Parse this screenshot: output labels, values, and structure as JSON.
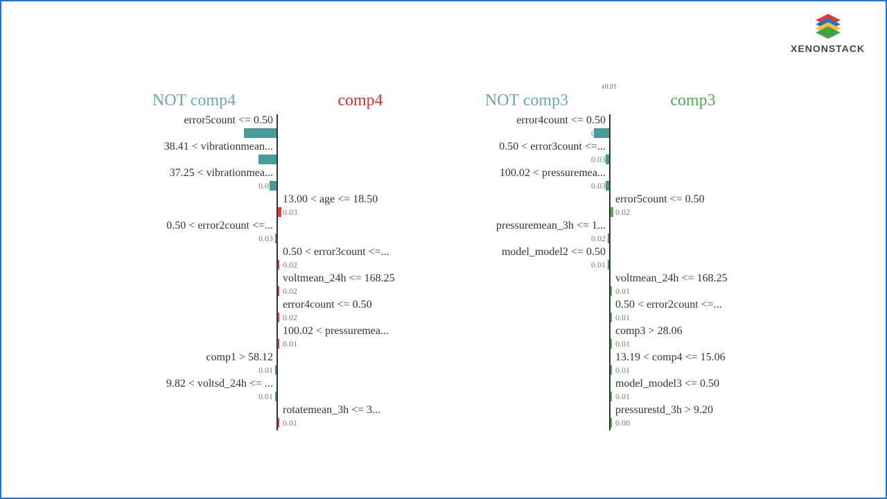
{
  "brand": "XENONSTACK",
  "left": {
    "neg_title": "NOT comp4",
    "pos_title": "comp4",
    "rows": [
      {
        "side": "neg",
        "label": "error5count <= 0.50",
        "value": "0.25"
      },
      {
        "side": "neg",
        "label": "38.41 < vibrationmean...",
        "value": "0.14"
      },
      {
        "side": "neg",
        "label": "37.25 < vibrationmea...",
        "value": "0.05"
      },
      {
        "side": "pos",
        "label": "13.00 < age <= 18.50",
        "value": "0.03"
      },
      {
        "side": "neg",
        "label": "0.50 < error2count <=...",
        "value": "0.03"
      },
      {
        "side": "pos",
        "label": "0.50 < error3count <=...",
        "value": "0.02"
      },
      {
        "side": "pos",
        "label": "voltmean_24h <= 168.25",
        "value": "0.02"
      },
      {
        "side": "pos",
        "label": "error4count <= 0.50",
        "value": "0.02"
      },
      {
        "side": "pos",
        "label": "100.02 < pressuremea...",
        "value": "0.01"
      },
      {
        "side": "neg",
        "label": "comp1 > 58.12",
        "value": "0.01"
      },
      {
        "side": "neg",
        "label": "9.82 < voltsd_24h <= ...",
        "value": "0.01"
      },
      {
        "side": "pos",
        "label": "rotatemean_3h <= 3...",
        "value": "0.01"
      }
    ]
  },
  "right": {
    "top_tick": "0.01",
    "neg_title": "NOT comp3",
    "pos_title": "comp3",
    "rows": [
      {
        "side": "neg",
        "label": "error4count <= 0.50",
        "value": "0.12"
      },
      {
        "side": "neg",
        "label": "0.50 < error3count <=...",
        "value": "0.03"
      },
      {
        "side": "neg",
        "label": "100.02 < pressuremea...",
        "value": "0.03"
      },
      {
        "side": "pos",
        "label": "error5count <= 0.50",
        "value": "0.02"
      },
      {
        "side": "neg",
        "label": "pressuremean_3h <= 1...",
        "value": "0.02"
      },
      {
        "side": "neg",
        "label": "model_model2 <= 0.50",
        "value": "0.01"
      },
      {
        "side": "pos",
        "label": "voltmean_24h <= 168.25",
        "value": "0.01"
      },
      {
        "side": "pos",
        "label": "0.50 < error2count <=...",
        "value": "0.01"
      },
      {
        "side": "pos",
        "label": "comp3 > 28.06",
        "value": "0.01"
      },
      {
        "side": "pos",
        "label": "13.19 < comp4 <= 15.06",
        "value": "0.01"
      },
      {
        "side": "pos",
        "label": "model_model3 <= 0.50",
        "value": "0.01"
      },
      {
        "side": "pos",
        "label": "pressurestd_3h > 9.20",
        "value": "0.00"
      }
    ]
  },
  "chart_data": [
    {
      "type": "bar",
      "title": "NOT comp4 / comp4",
      "orientation": "horizontal-diverging",
      "neg_class": "NOT comp4",
      "pos_class": "comp4",
      "neg_color": "#479b9b",
      "pos_color": "#e53935",
      "features": [
        {
          "feature": "error5count <= 0.50",
          "weight": -0.25
        },
        {
          "feature": "38.41 < vibrationmean...",
          "weight": -0.14
        },
        {
          "feature": "37.25 < vibrationmea...",
          "weight": -0.05
        },
        {
          "feature": "13.00 < age <= 18.50",
          "weight": 0.03
        },
        {
          "feature": "0.50 < error2count <=...",
          "weight": -0.03
        },
        {
          "feature": "0.50 < error3count <=...",
          "weight": 0.02
        },
        {
          "feature": "voltmean_24h <= 168.25",
          "weight": 0.02
        },
        {
          "feature": "error4count <= 0.50",
          "weight": 0.02
        },
        {
          "feature": "100.02 < pressuremea...",
          "weight": 0.01
        },
        {
          "feature": "comp1 > 58.12",
          "weight": -0.01
        },
        {
          "feature": "9.82 < voltsd_24h <= ...",
          "weight": -0.01
        },
        {
          "feature": "rotatemean_3h <= 3...",
          "weight": 0.01
        }
      ]
    },
    {
      "type": "bar",
      "title": "NOT comp3 / comp3",
      "orientation": "horizontal-diverging",
      "neg_class": "NOT comp3",
      "pos_class": "comp3",
      "neg_color": "#479b9b",
      "pos_color": "#4caf50",
      "top_tick": 0.01,
      "features": [
        {
          "feature": "error4count <= 0.50",
          "weight": -0.12
        },
        {
          "feature": "0.50 < error3count <=...",
          "weight": -0.03
        },
        {
          "feature": "100.02 < pressuremea...",
          "weight": -0.03
        },
        {
          "feature": "error5count <= 0.50",
          "weight": 0.02
        },
        {
          "feature": "pressuremean_3h <= 1...",
          "weight": -0.02
        },
        {
          "feature": "model_model2 <= 0.50",
          "weight": -0.01
        },
        {
          "feature": "voltmean_24h <= 168.25",
          "weight": 0.01
        },
        {
          "feature": "0.50 < error2count <=...",
          "weight": 0.01
        },
        {
          "feature": "comp3 > 28.06",
          "weight": 0.01
        },
        {
          "feature": "13.19 < comp4 <= 15.06",
          "weight": 0.01
        },
        {
          "feature": "model_model3 <= 0.50",
          "weight": 0.01
        },
        {
          "feature": "pressurestd_3h > 9.20",
          "weight": 0.0
        }
      ]
    }
  ]
}
